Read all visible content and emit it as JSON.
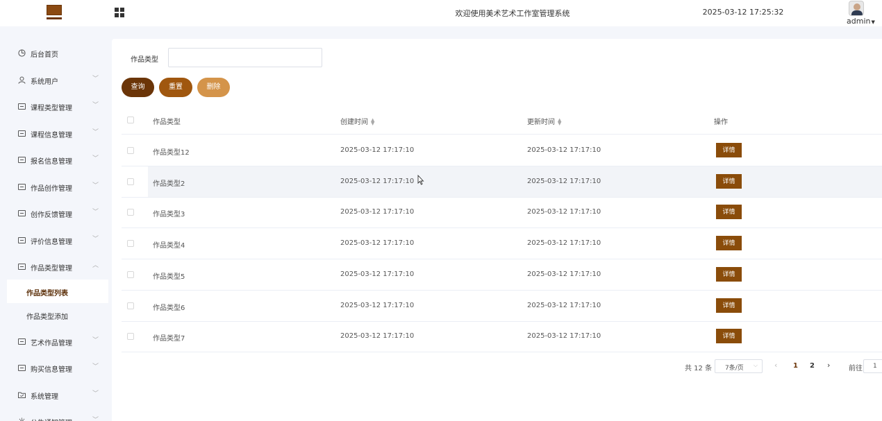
{
  "header": {
    "system_title": "欢迎使用美术艺术工作室管理系统",
    "datetime": "2025-03-12 17:25:32",
    "user": "admin"
  },
  "sidebar": {
    "items": [
      {
        "label": "后台首页",
        "icon": "clock-icon",
        "expandable": false
      },
      {
        "label": "系统用户",
        "icon": "user-icon",
        "expandable": true
      },
      {
        "label": "课程类型管理",
        "icon": "list-icon",
        "expandable": true
      },
      {
        "label": "课程信息管理",
        "icon": "list-icon",
        "expandable": true
      },
      {
        "label": "报名信息管理",
        "icon": "list-icon",
        "expandable": true
      },
      {
        "label": "作品创作管理",
        "icon": "list-icon",
        "expandable": true
      },
      {
        "label": "创作反馈管理",
        "icon": "list-icon",
        "expandable": true
      },
      {
        "label": "评价信息管理",
        "icon": "list-icon",
        "expandable": true
      },
      {
        "label": "作品类型管理",
        "icon": "list-icon",
        "expandable": true,
        "expanded": true
      },
      {
        "label": "艺术作品管理",
        "icon": "list-icon",
        "expandable": true
      },
      {
        "label": "购买信息管理",
        "icon": "list-icon",
        "expandable": true
      },
      {
        "label": "系统管理",
        "icon": "folder-icon",
        "expandable": true
      },
      {
        "label": "公告通知管理",
        "icon": "gear-icon",
        "expandable": true
      }
    ],
    "sub_items": [
      {
        "label": "作品类型列表",
        "active": true
      },
      {
        "label": "作品类型添加",
        "active": false
      }
    ]
  },
  "search": {
    "label": "作品类型",
    "value": "",
    "placeholder": ""
  },
  "buttons": {
    "query": "查询",
    "reset": "重置",
    "delete": "删除"
  },
  "table": {
    "columns": [
      "作品类型",
      "创建时间",
      "更新时间",
      "操作"
    ],
    "detail_label": "详情",
    "rows": [
      {
        "type": "作品类型12",
        "created": "2025-03-12 17:17:10",
        "updated": "2025-03-12 17:17:10"
      },
      {
        "type": "作品类型2",
        "created": "2025-03-12 17:17:10",
        "updated": "2025-03-12 17:17:10"
      },
      {
        "type": "作品类型3",
        "created": "2025-03-12 17:17:10",
        "updated": "2025-03-12 17:17:10"
      },
      {
        "type": "作品类型4",
        "created": "2025-03-12 17:17:10",
        "updated": "2025-03-12 17:17:10"
      },
      {
        "type": "作品类型5",
        "created": "2025-03-12 17:17:10",
        "updated": "2025-03-12 17:17:10"
      },
      {
        "type": "作品类型6",
        "created": "2025-03-12 17:17:10",
        "updated": "2025-03-12 17:17:10"
      },
      {
        "type": "作品类型7",
        "created": "2025-03-12 17:17:10",
        "updated": "2025-03-12 17:17:10"
      }
    ]
  },
  "pagination": {
    "total": "共 12 条",
    "page_size": "7条/页",
    "pages": [
      "1",
      "2"
    ],
    "current_page": "1",
    "goto_label": "前往",
    "goto_value": "1"
  },
  "colors": {
    "primary_dark": "#6b3508",
    "primary": "#a0570f",
    "primary_light": "#d4944a",
    "detail_button": "#8a4c0a"
  }
}
